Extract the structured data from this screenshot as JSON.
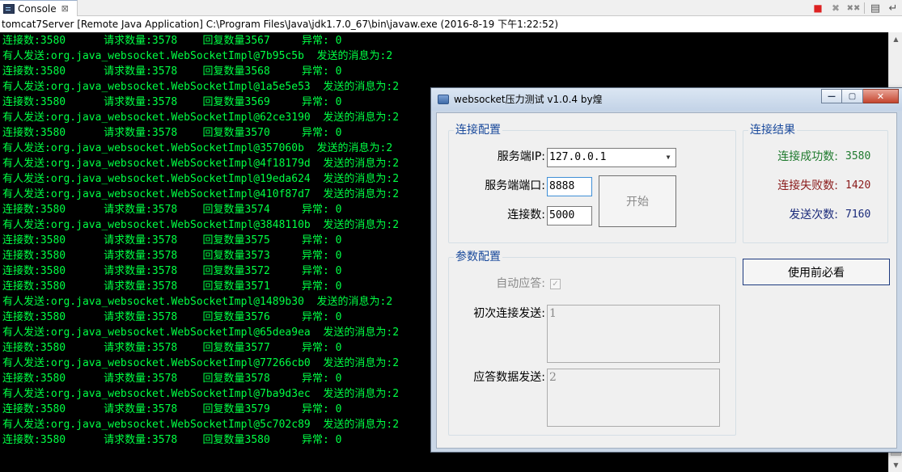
{
  "console_tab": {
    "label": "Console",
    "close_glyph": "⊠"
  },
  "toolbar": {
    "icons": [
      "terminate-icon",
      "remove-launch-icon",
      "remove-all-icon",
      "scroll-lock-icon",
      "word-wrap-icon"
    ]
  },
  "launch_info": "tomcat7Server [Remote Java Application] C:\\Program Files\\Java\\jdk1.7.0_67\\bin\\javaw.exe (2016-8-19 下午1:22:52)",
  "log_lines": [
    "连接数:3580      请求数量:3578    回复数量3567     异常: 0",
    "有人发送:org.java_websocket.WebSocketImpl@7b95c5b  发送的消息为:2",
    "连接数:3580      请求数量:3578    回复数量3568     异常: 0",
    "有人发送:org.java_websocket.WebSocketImpl@1a5e5e53  发送的消息为:2",
    "连接数:3580      请求数量:3578    回复数量3569     异常: 0",
    "有人发送:org.java_websocket.WebSocketImpl@62ce3190  发送的消息为:2",
    "连接数:3580      请求数量:3578    回复数量3570     异常: 0",
    "有人发送:org.java_websocket.WebSocketImpl@357060b  发送的消息为:2",
    "有人发送:org.java_websocket.WebSocketImpl@4f18179d  发送的消息为:2",
    "有人发送:org.java_websocket.WebSocketImpl@19eda624  发送的消息为:2",
    "有人发送:org.java_websocket.WebSocketImpl@410f87d7  发送的消息为:2",
    "连接数:3580      请求数量:3578    回复数量3574     异常: 0",
    "有人发送:org.java_websocket.WebSocketImpl@3848110b  发送的消息为:2",
    "连接数:3580      请求数量:3578    回复数量3575     异常: 0",
    "连接数:3580      请求数量:3578    回复数量3573     异常: 0",
    "连接数:3580      请求数量:3578    回复数量3572     异常: 0",
    "连接数:3580      请求数量:3578    回复数量3571     异常: 0",
    "有人发送:org.java_websocket.WebSocketImpl@1489b30  发送的消息为:2",
    "连接数:3580      请求数量:3578    回复数量3576     异常: 0",
    "有人发送:org.java_websocket.WebSocketImpl@65dea9ea  发送的消息为:2",
    "连接数:3580      请求数量:3578    回复数量3577     异常: 0",
    "有人发送:org.java_websocket.WebSocketImpl@77266cb0  发送的消息为:2",
    "连接数:3580      请求数量:3578    回复数量3578     异常: 0",
    "有人发送:org.java_websocket.WebSocketImpl@7ba9d3ec  发送的消息为:2",
    "连接数:3580      请求数量:3578    回复数量3579     异常: 0",
    "有人发送:org.java_websocket.WebSocketImpl@5c702c89  发送的消息为:2",
    "连接数:3580      请求数量:3578    回复数量3580     异常: 0"
  ],
  "dialog": {
    "title": "websocket压力测试 v1.0.4 by煌",
    "window_buttons": {
      "minimize": "—",
      "maximize": "▢",
      "close": "✕"
    },
    "connection_config": {
      "title": "连接配置",
      "server_ip_label": "服务端IP:",
      "server_ip_value": "127.0.0.1",
      "server_port_label": "服务端端口:",
      "server_port_value": "8888",
      "connections_label": "连接数:",
      "connections_value": "5000",
      "start_button": "开始"
    },
    "connection_result": {
      "title": "连接结果",
      "success_label": "连接成功数:",
      "success_value": "3580",
      "fail_label": "连接失败数:",
      "fail_value": "1420",
      "send_label": "发送次数:",
      "send_value": "7160"
    },
    "must_read_button": "使用前必看",
    "param_config": {
      "title": "参数配置",
      "auto_reply_label": "自动应答:",
      "auto_reply_checked": true,
      "auto_reply_check_glyph": "✓",
      "first_send_label": "初次连接发送:",
      "first_send_value": "1",
      "reply_data_label": "应答数据发送:",
      "reply_data_value": "2"
    }
  },
  "colors": {
    "console_bg": "#000000",
    "console_text": "#00ff44",
    "group_title": "#1a4a9c",
    "success": "#1f7a2e",
    "fail": "#8a1a1a",
    "send": "#1a2a7a"
  }
}
